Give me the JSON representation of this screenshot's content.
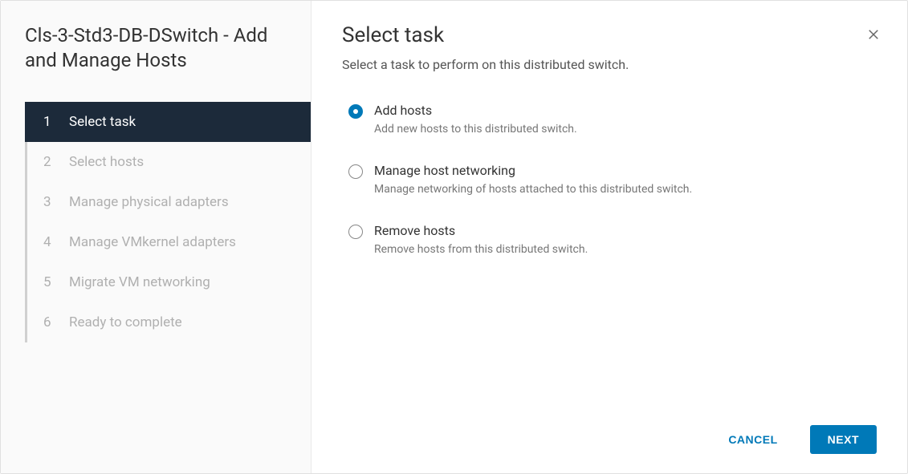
{
  "sidebar": {
    "title": "Cls-3-Std3-DB-DSwitch - Add and Manage Hosts",
    "steps": [
      {
        "num": "1",
        "label": "Select task",
        "active": true
      },
      {
        "num": "2",
        "label": "Select hosts",
        "active": false
      },
      {
        "num": "3",
        "label": "Manage physical adapters",
        "active": false
      },
      {
        "num": "4",
        "label": "Manage VMkernel adapters",
        "active": false
      },
      {
        "num": "5",
        "label": "Migrate VM networking",
        "active": false
      },
      {
        "num": "6",
        "label": "Ready to complete",
        "active": false
      }
    ]
  },
  "main": {
    "title": "Select task",
    "subtitle": "Select a task to perform on this distributed switch.",
    "options": [
      {
        "label": "Add hosts",
        "desc": "Add new hosts to this distributed switch.",
        "selected": true
      },
      {
        "label": "Manage host networking",
        "desc": "Manage networking of hosts attached to this distributed switch.",
        "selected": false
      },
      {
        "label": "Remove hosts",
        "desc": "Remove hosts from this distributed switch.",
        "selected": false
      }
    ]
  },
  "footer": {
    "cancel": "CANCEL",
    "next": "NEXT"
  }
}
